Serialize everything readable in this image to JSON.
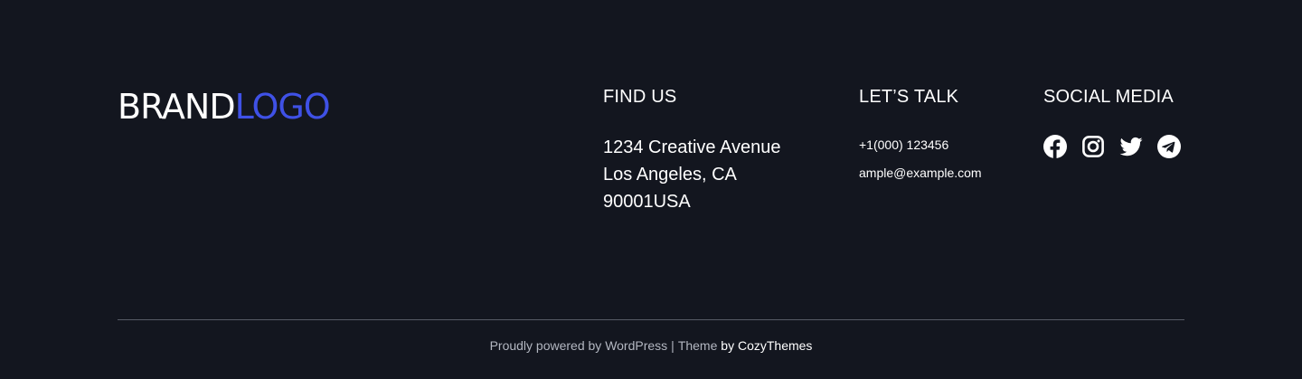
{
  "brand": {
    "part1": "BRAND",
    "part2": "LOGO",
    "accent_color": "#3f51e6"
  },
  "find_us": {
    "heading": "FIND US",
    "address_lines": [
      "1234 Creative Avenue",
      "Los Angeles, CA",
      "90001USA"
    ]
  },
  "lets_talk": {
    "heading": "LET’S TALK",
    "phone": "+1(000) 123456",
    "email": "ample@example.com"
  },
  "social_media": {
    "heading": "SOCIAL MEDIA",
    "icons": [
      "facebook-icon",
      "instagram-icon",
      "twitter-icon",
      "telegram-icon"
    ]
  },
  "footer": {
    "powered_text": "Proudly powered by WordPress",
    "separator": "|",
    "theme_text": "Theme",
    "theme_link": "by CozyThemes"
  },
  "colors": {
    "background": "#13161f",
    "divider": "#575b66",
    "muted_text": "#b3b7c1"
  }
}
